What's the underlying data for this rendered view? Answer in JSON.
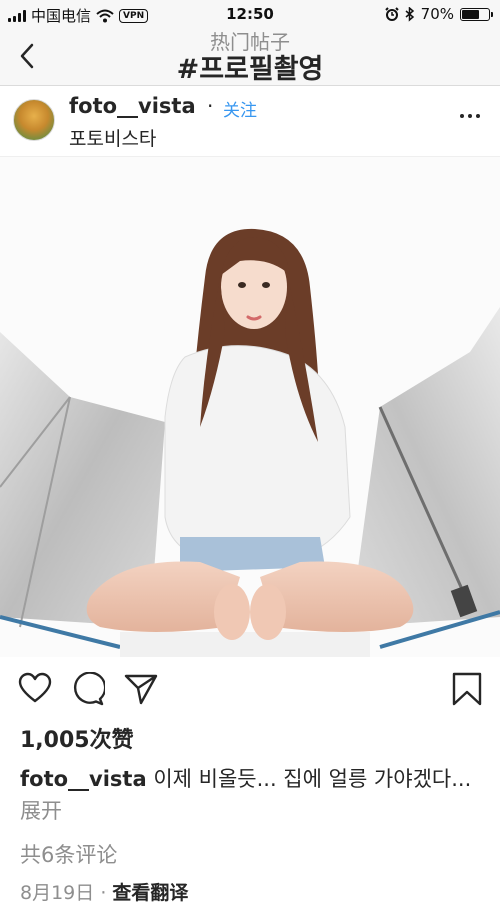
{
  "status_bar": {
    "carrier": "中国电信",
    "vpn": "VPN",
    "time": "12:50",
    "battery": "70%",
    "battery_level": 0.7
  },
  "nav": {
    "subtitle": "热门帖子",
    "title": "#프로필촬영"
  },
  "post": {
    "username": "foto__vista",
    "follow_label": "关注",
    "location": "포토비스타",
    "likes": "1,005次赞",
    "caption_user": "foto__vista",
    "caption_text": "이제 비올듯... 집에 얼릉 가야겠다...",
    "expand_label": "展开",
    "comments_link": "共6条评论",
    "date": "8月19日",
    "translate_label": "查看翻译"
  },
  "colors": {
    "link_blue": "#3897f0",
    "text": "#262626",
    "muted": "#8e8e8e"
  },
  "icons": [
    "back-icon",
    "heart-icon",
    "comment-icon",
    "share-icon",
    "bookmark-icon",
    "more-icon",
    "wifi-icon",
    "alarm-icon",
    "bluetooth-icon",
    "battery-icon"
  ]
}
